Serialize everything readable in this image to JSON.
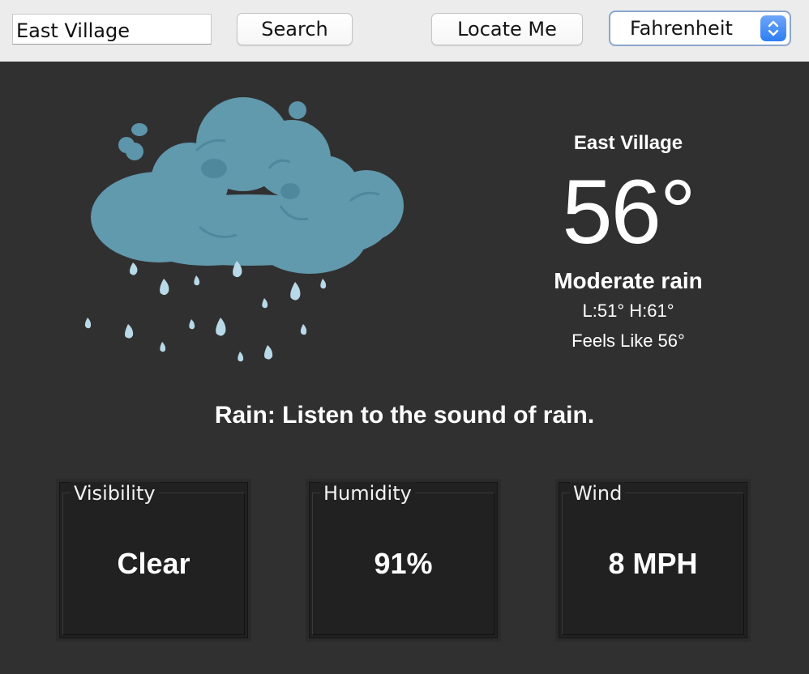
{
  "toolbar": {
    "search_value": "East Village",
    "search_label": "Search",
    "locate_label": "Locate Me",
    "unit_selected": "Fahrenheit"
  },
  "icons": {
    "weather": "rain-cloud-icon",
    "select_arrows": "chevron-up-down-icon"
  },
  "current": {
    "city": "East Village",
    "temperature": "56°",
    "description": "Moderate rain",
    "low_high": "L:51° H:61°",
    "feels_like": "Feels Like 56°",
    "tagline": "Rain: Listen to the sound of rain."
  },
  "cards": [
    {
      "title": "Visibility",
      "value": "Clear"
    },
    {
      "title": "Humidity",
      "value": "91%"
    },
    {
      "title": "Wind",
      "value": "8 MPH"
    }
  ],
  "colors": {
    "background": "#313031",
    "toolbar": "#ececec",
    "card": "#222122",
    "cloud": "#6199ad",
    "select_accent": "#2c7ef2"
  }
}
